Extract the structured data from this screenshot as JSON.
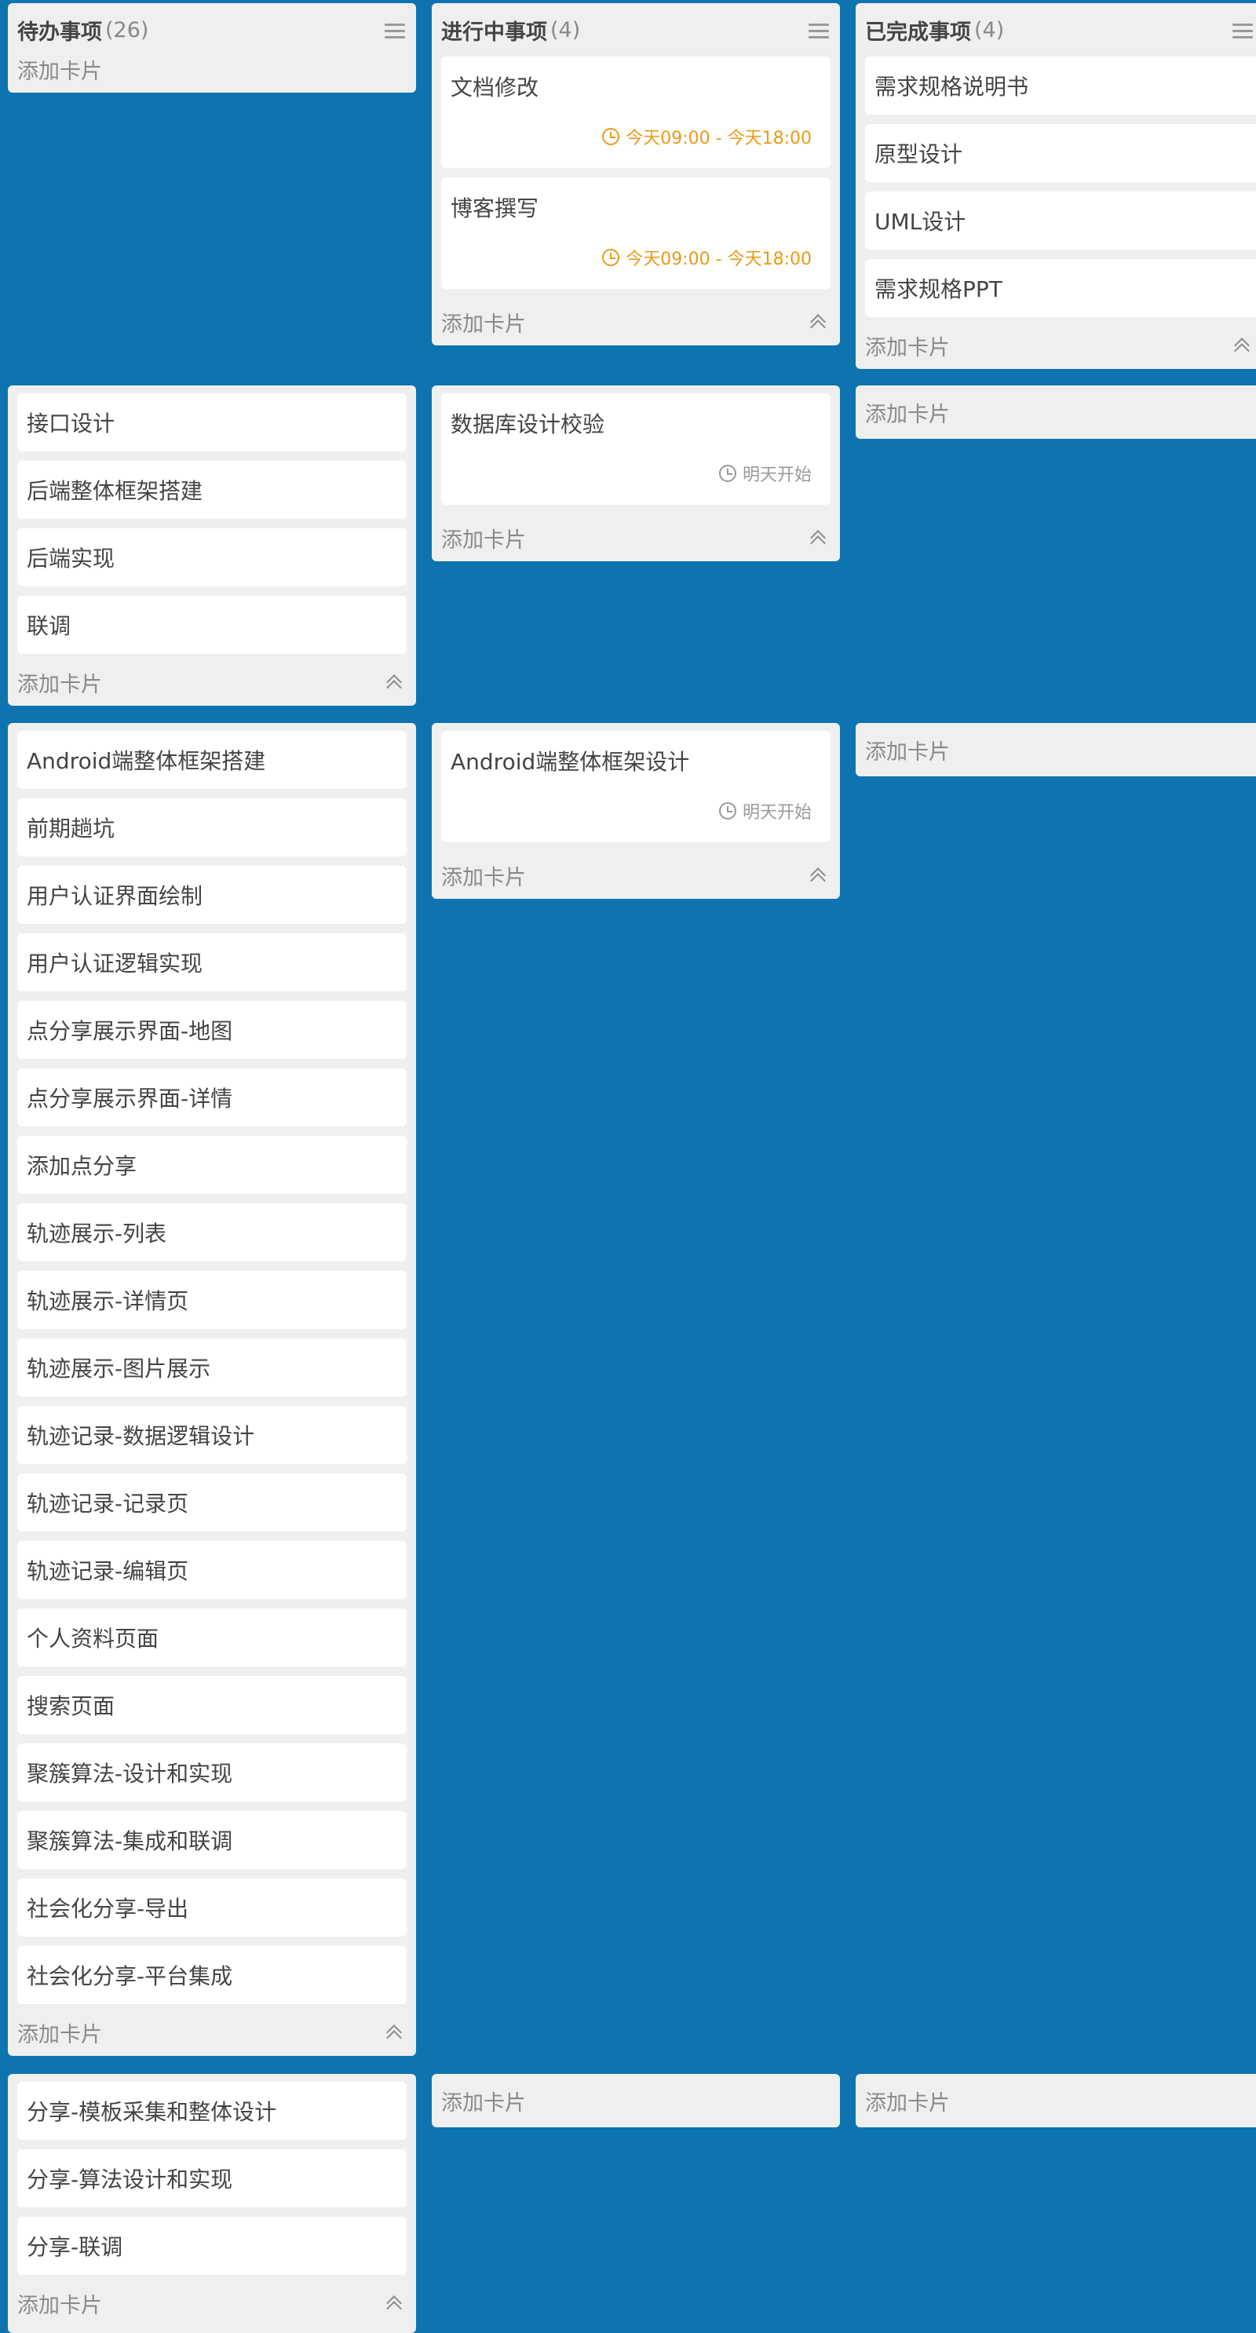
{
  "lanes": {
    "todo": {
      "title": "待办事项",
      "count": "(26)"
    },
    "in_progress": {
      "title": "进行中事项",
      "count": "(4)"
    },
    "done": {
      "title": "已完成事项",
      "count": "(4)"
    }
  },
  "add_card_label": "添加卡片",
  "row1": {
    "todo": [],
    "in_progress": [
      {
        "title": "文档修改",
        "time": "今天09:00 - 今天18:00"
      },
      {
        "title": "博客撰写",
        "time": "今天09:00 - 今天18:00"
      }
    ],
    "done": [
      "需求规格说明书",
      "原型设计",
      "UML设计",
      "需求规格PPT"
    ]
  },
  "row2": {
    "todo": [
      "接口设计",
      "后端整体框架搭建",
      "后端实现",
      "联调"
    ],
    "in_progress": [
      {
        "title": "数据库设计校验",
        "time": "明天开始"
      }
    ],
    "done": []
  },
  "row3": {
    "todo": [
      "Android端整体框架搭建",
      "前期趟坑",
      "用户认证界面绘制",
      "用户认证逻辑实现",
      "点分享展示界面-地图",
      "点分享展示界面-详情",
      "添加点分享",
      "轨迹展示-列表",
      "轨迹展示-详情页",
      "轨迹展示-图片展示",
      "轨迹记录-数据逻辑设计",
      "轨迹记录-记录页",
      "轨迹记录-编辑页",
      "个人资料页面",
      "搜索页面",
      "聚簇算法-设计和实现",
      "聚簇算法-集成和联调",
      "社会化分享-导出",
      "社会化分享-平台集成"
    ],
    "in_progress": [
      {
        "title": "Android端整体框架设计",
        "time": "明天开始"
      }
    ],
    "done": []
  },
  "row4": {
    "todo": [
      "分享-模板采集和整体设计",
      "分享-算法设计和实现",
      "分享-联调"
    ],
    "in_progress": [],
    "done": []
  },
  "colors": {
    "board_background": "#0e74b0",
    "list_background": "#efefef",
    "today_time": "#e99a17",
    "tomorrow_time": "#999999"
  }
}
